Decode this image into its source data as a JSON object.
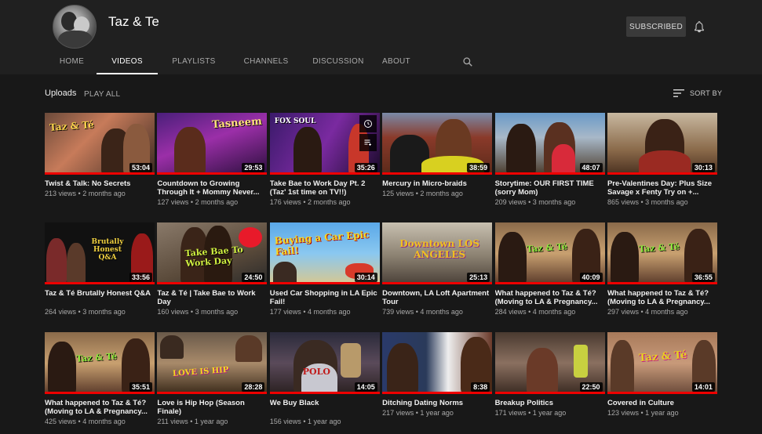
{
  "channel": {
    "name": "Taz & Te",
    "subscribe_label": "SUBSCRIBED"
  },
  "tabs": [
    "HOME",
    "VIDEOS",
    "PLAYLISTS",
    "CHANNELS",
    "DISCUSSION",
    "ABOUT"
  ],
  "active_tab": "VIDEOS",
  "section": {
    "title": "Uploads",
    "play_all": "PLAY ALL",
    "sort_label": "SORT BY"
  },
  "colors": {
    "background": "#181818",
    "header": "#202020",
    "progress": "#ee0000"
  },
  "videos": [
    {
      "title": "Twist & Talk: No Secrets",
      "views": "213 views",
      "age": "2 months ago",
      "duration": "53:04",
      "thumb_text": "Taz & Té",
      "watched": 1.0
    },
    {
      "title": "Countdown to Growing Through It + Mommy Never...",
      "views": "127 views",
      "age": "2 months ago",
      "duration": "29:53",
      "thumb_text": "Tasneem",
      "watched": 1.0
    },
    {
      "title": "Take Bae to Work Day Pt. 2 (Taz' 1st time on TV!!)",
      "views": "176 views",
      "age": "2 months ago",
      "duration": "35:26",
      "thumb_text": "FOX SOUL",
      "watched": 1.0
    },
    {
      "title": "Mercury in Micro-braids",
      "views": "125 views",
      "age": "2 months ago",
      "duration": "38:59",
      "thumb_text": "",
      "watched": 1.0
    },
    {
      "title": "Storytime: OUR FIRST TIME (sorry Mom)",
      "views": "209 views",
      "age": "3 months ago",
      "duration": "48:07",
      "thumb_text": "",
      "watched": 1.0
    },
    {
      "title": "Pre-Valentines Day: Plus Size Savage x Fenty Try on +...",
      "views": "865 views",
      "age": "3 months ago",
      "duration": "30:13",
      "thumb_text": "",
      "watched": 1.0
    },
    {
      "title": "Taz & Té Brutally Honest Q&A",
      "views": "264 views",
      "age": "3 months ago",
      "duration": "33:56",
      "thumb_text": "Brutally Honest Q&A",
      "watched": 1.0
    },
    {
      "title": "Taz & Té | Take Bae to Work Day",
      "views": "160 views",
      "age": "3 months ago",
      "duration": "24:50",
      "thumb_text": "Take Bae To Work Day",
      "watched": 1.0
    },
    {
      "title": "Used Car Shopping in LA Epic Fail!",
      "views": "177 views",
      "age": "4 months ago",
      "duration": "30:14",
      "thumb_text": "Buying a Car Epic Fail!",
      "watched": 1.0
    },
    {
      "title": "Downtown, LA Loft Apartment Tour",
      "views": "739 views",
      "age": "4 months ago",
      "duration": "25:13",
      "thumb_text": "Downtown LOS ANGELES",
      "watched": 1.0
    },
    {
      "title": "What happened to Taz & Té? (Moving to LA & Pregnancy...",
      "views": "284 views",
      "age": "4 months ago",
      "duration": "40:09",
      "thumb_text": "Taz & Té",
      "watched": 1.0
    },
    {
      "title": "What happened to Taz & Té? (Moving to LA & Pregnancy...",
      "views": "297 views",
      "age": "4 months ago",
      "duration": "36:55",
      "thumb_text": "Taz & Té",
      "watched": 1.0
    },
    {
      "title": "What happened to Taz & Té? (Moving to LA & Pregnancy...",
      "views": "425 views",
      "age": "4 months ago",
      "duration": "35:51",
      "thumb_text": "Taz & Té",
      "watched": 1.0
    },
    {
      "title": "Love is Hip Hop (Season Finale)",
      "views": "211 views",
      "age": "1 year ago",
      "duration": "28:28",
      "thumb_text": "LOVE IS HIP",
      "watched": 1.0
    },
    {
      "title": "We Buy Black",
      "views": "156 views",
      "age": "1 year ago",
      "duration": "14:05",
      "thumb_text": "POLO",
      "watched": 1.0
    },
    {
      "title": "Ditching Dating Norms",
      "views": "217 views",
      "age": "1 year ago",
      "duration": "8:38",
      "thumb_text": "",
      "watched": 1.0
    },
    {
      "title": "Breakup Politics",
      "views": "171 views",
      "age": "1 year ago",
      "duration": "22:50",
      "thumb_text": "",
      "watched": 1.0
    },
    {
      "title": "Covered in Culture",
      "views": "123 views",
      "age": "1 year ago",
      "duration": "14:01",
      "thumb_text": "Taz & Té",
      "watched": 1.0
    }
  ]
}
